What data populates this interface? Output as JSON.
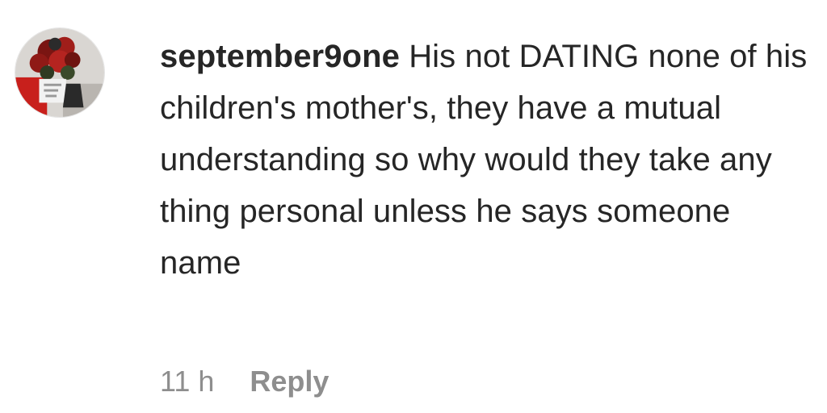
{
  "comment": {
    "avatar_icon": "profile-avatar-flowers",
    "username": "september9one",
    "text": "His not DATING none of his children's mother's, they have a mutual understanding so why would they take any thing personal unless he says someone name",
    "timestamp": "11 h",
    "reply_label": "Reply"
  }
}
